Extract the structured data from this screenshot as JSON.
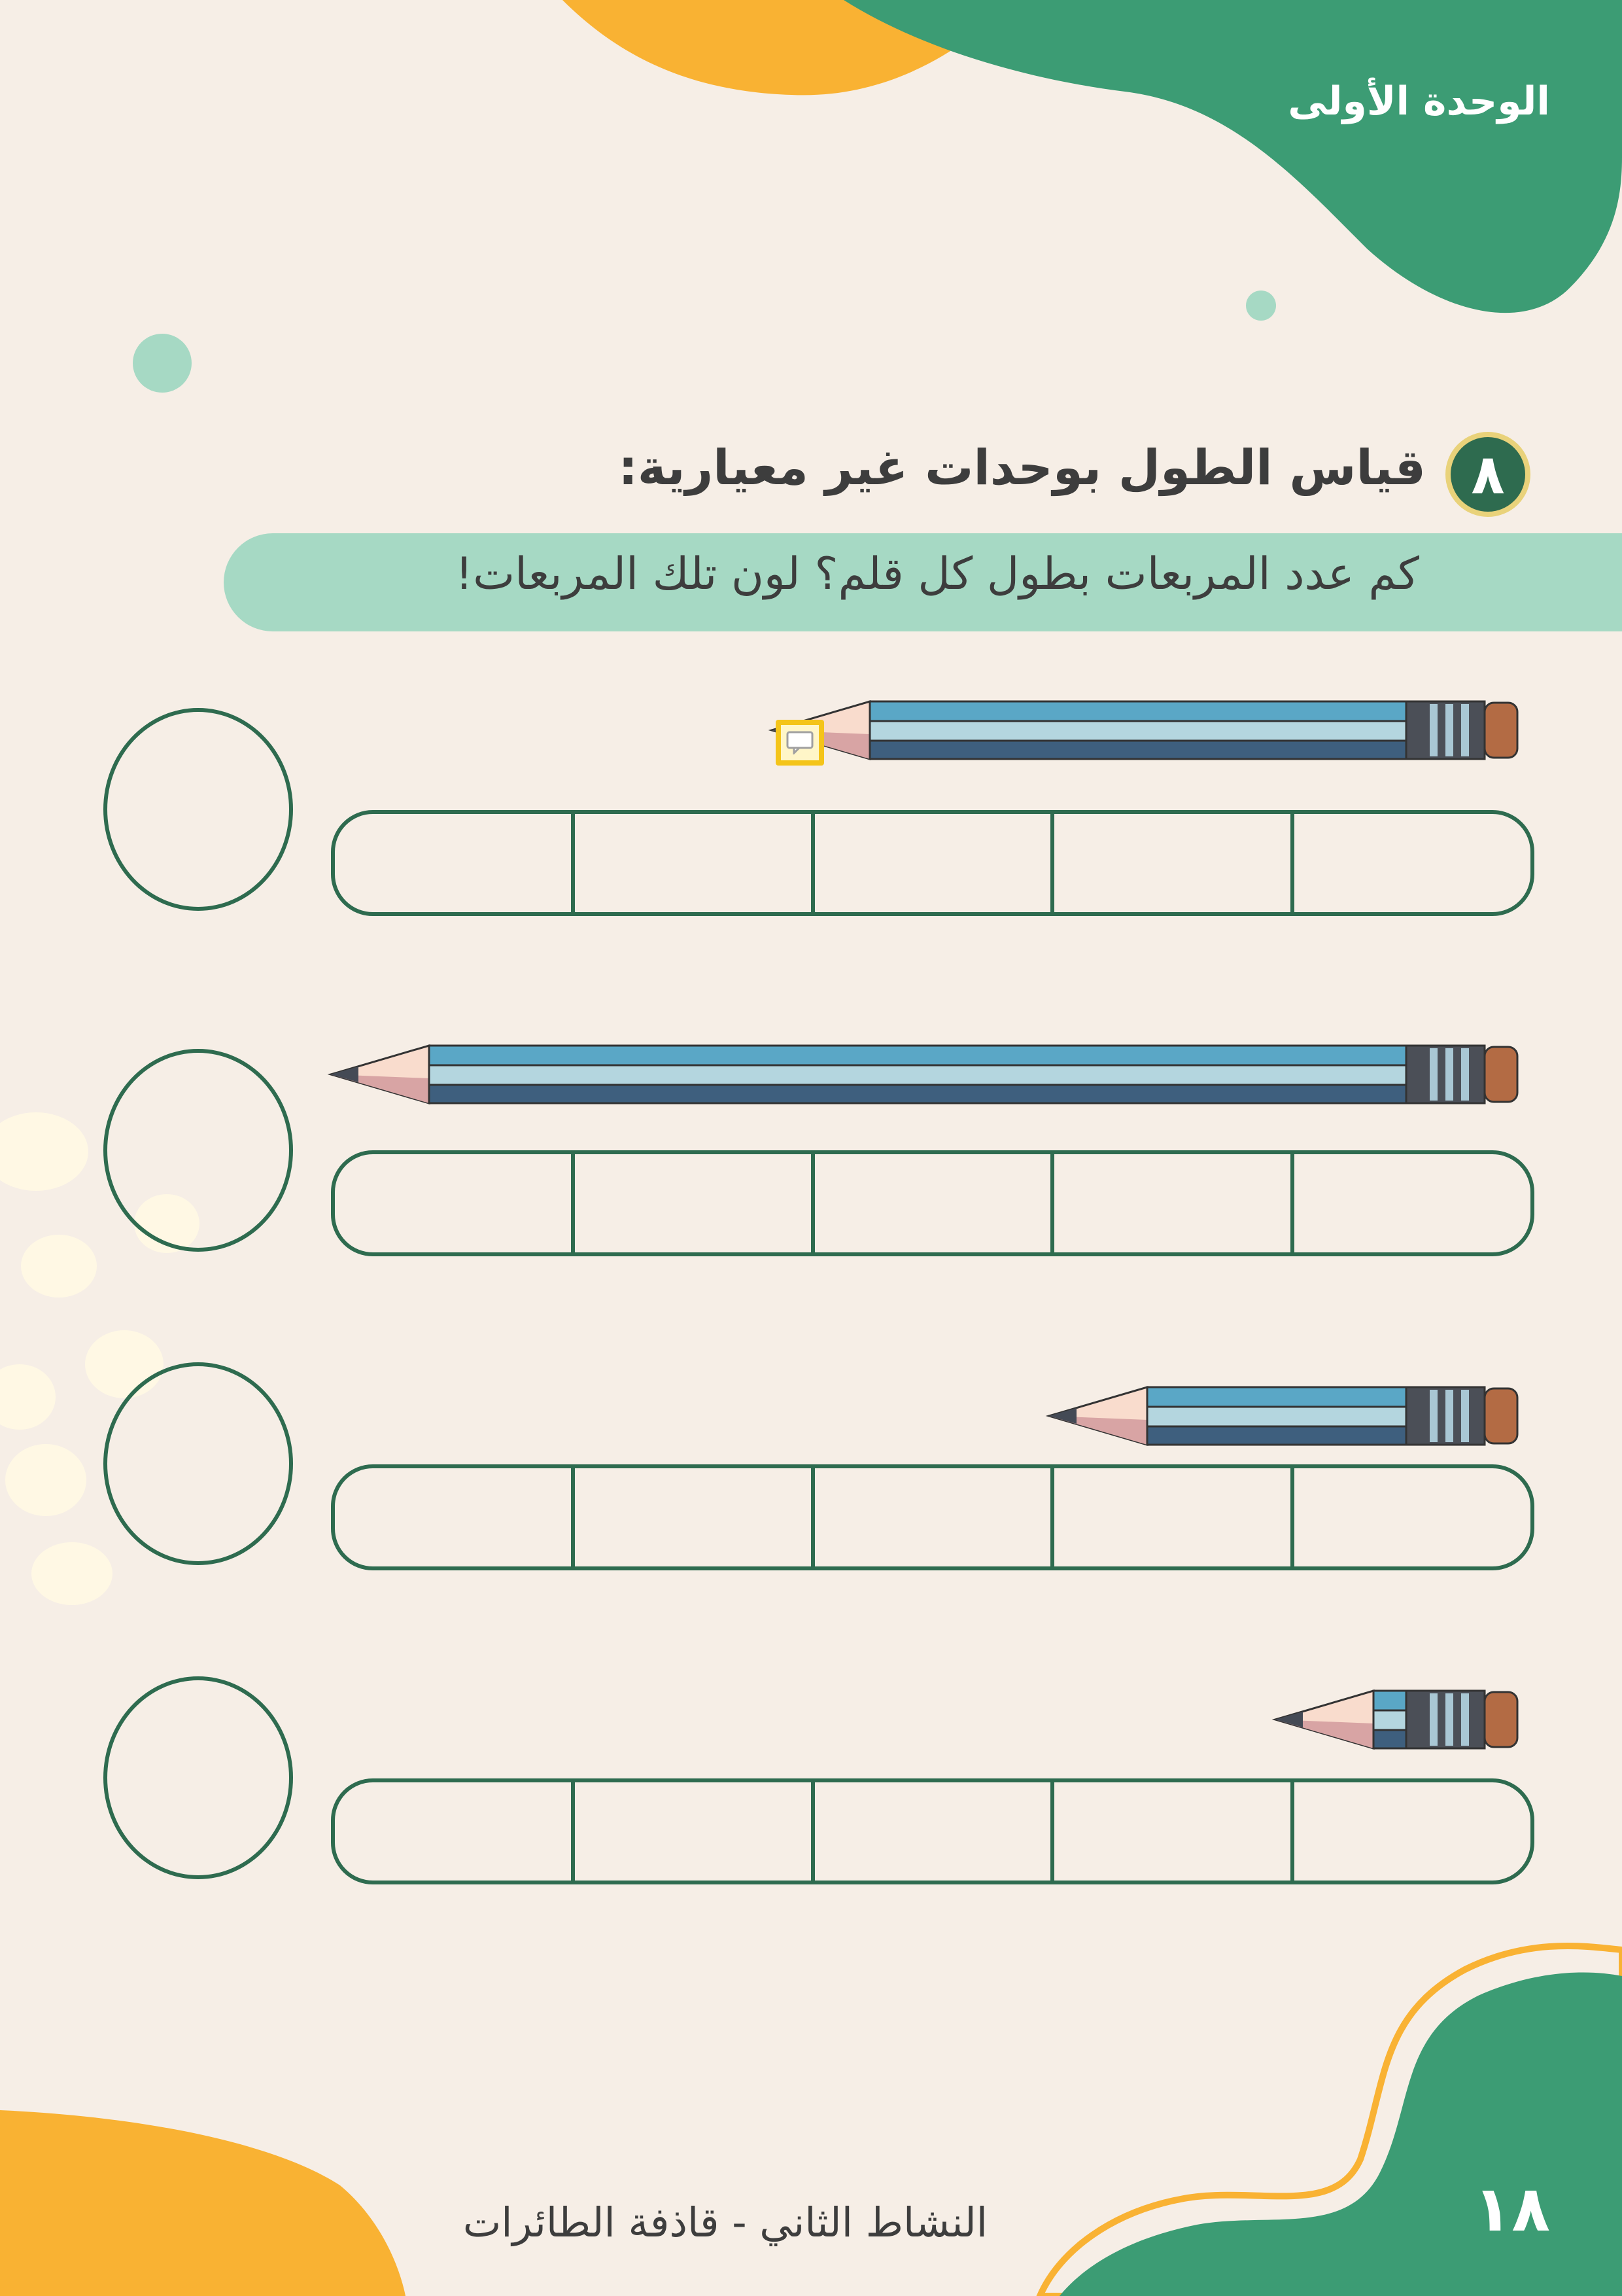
{
  "header": {
    "unit_label": "الوحدة الأولى"
  },
  "exercise": {
    "number": "٨",
    "title": "قياس الطول بوحدات غير معيارية:",
    "instruction": "كم عدد المربعات بطول كل قلم؟ لون تلك المربعات!"
  },
  "rows": [
    {
      "pencil_length_squares": 3,
      "squares": 5
    },
    {
      "pencil_length_squares": 5,
      "squares": 5
    },
    {
      "pencil_length_squares": 2,
      "squares": 5
    },
    {
      "pencil_length_squares": 1,
      "squares": 5
    }
  ],
  "footer": {
    "activity_title": "النشاط الثاني - قاذفة الطائرات",
    "page_number": "١٨"
  },
  "colors": {
    "background": "#f6eee6",
    "green": "#3c9c74",
    "dark_green": "#2e6b4f",
    "orange": "#f9b233",
    "mint": "#a6d9c4",
    "pencil_blue": "#5aa7c6"
  },
  "icons": [
    "pencil-icon",
    "comment-icon"
  ]
}
